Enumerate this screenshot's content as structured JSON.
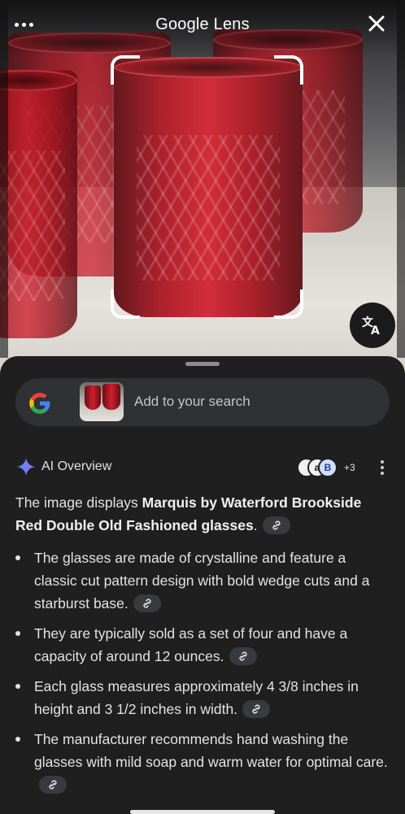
{
  "header": {
    "title": "Google Lens",
    "more_icon": "more-horizontal-icon",
    "close_icon": "close-icon"
  },
  "image": {
    "subject": "red-cut-glass-tumblers",
    "translate_icon": "translate-icon"
  },
  "search": {
    "placeholder": "Add to your search",
    "logo": "google-g-icon"
  },
  "ai_overview": {
    "title": "AI Overview",
    "source_badges": [
      "",
      "a",
      "B"
    ],
    "source_count": "+3",
    "intro_prefix": "The image displays ",
    "intro_bold": "Marquis by Waterford Brookside Red Double Old Fashioned glasses",
    "intro_suffix": ".",
    "bullets": [
      "The glasses are made of crystalline and feature a classic cut pattern design with bold wedge cuts and a starburst base.",
      "They are typically sold as a set of four and have a capacity of around 12 ounces.",
      "Each glass measures approximately 4 3/8 inches in height and 3 1/2 inches in width.",
      "The manufacturer recommends hand washing the glasses with mild soap and warm water for optimal care."
    ]
  },
  "colors": {
    "sheet_bg": "#1f1f1f",
    "searchbar_bg": "#303134",
    "text": "#e3e3e3",
    "glass_red": "#c41b28",
    "gemini_blue": "#4f8cf5"
  }
}
